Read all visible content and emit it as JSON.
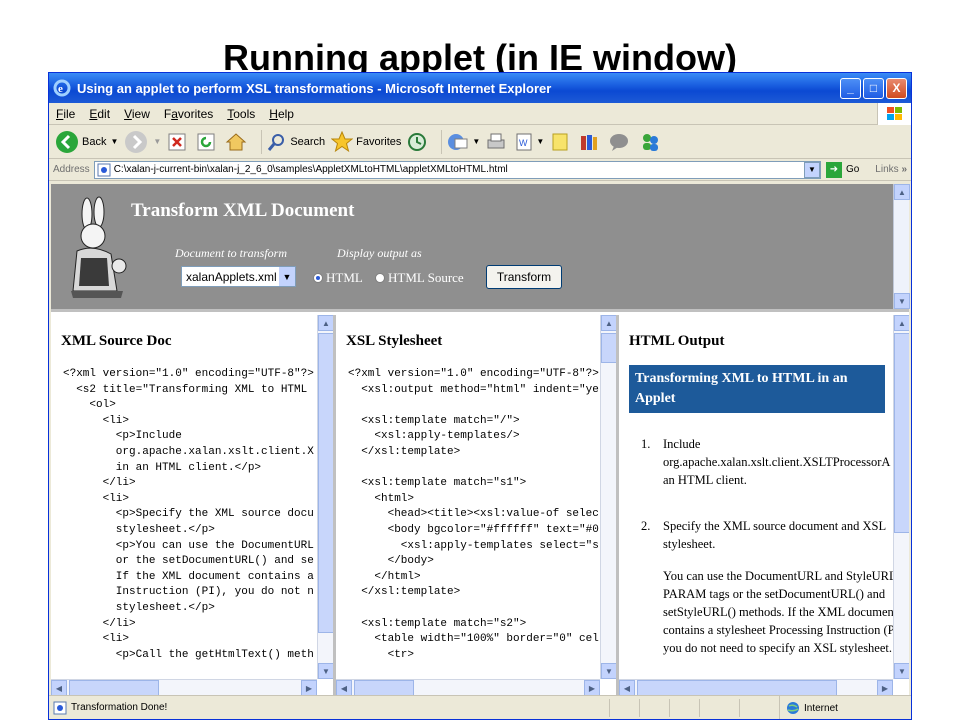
{
  "slide": {
    "title": "Running applet (in IE window)"
  },
  "window": {
    "title": "Using an applet to perform XSL transformations - Microsoft Internet Explorer",
    "controls": {
      "minimize": "_",
      "maximize": "□",
      "close": "X"
    }
  },
  "menu": {
    "items": [
      {
        "accel": "F",
        "rest": "ile"
      },
      {
        "accel": "E",
        "rest": "dit"
      },
      {
        "accel": "V",
        "rest": "iew"
      },
      {
        "accel": "a",
        "pre": "F",
        "rest": "vorites"
      },
      {
        "accel": "T",
        "rest": "ools"
      },
      {
        "accel": "H",
        "rest": "elp"
      }
    ]
  },
  "toolbar": {
    "back_label": "Back",
    "search_label": "Search",
    "favorites_label": "Favorites"
  },
  "address": {
    "label": "Address",
    "value": "C:\\xalan-j-current-bin\\xalan-j_2_6_0\\samples\\AppletXMLtoHTML\\appletXMLtoHTML.html",
    "go_label": "Go",
    "links_label": "Links"
  },
  "applet": {
    "heading": "Transform XML Document",
    "doc_label": "Document to transform",
    "display_label": "Display output as",
    "selected_doc": "xalanApplets.xml",
    "radio_html": "HTML",
    "radio_source": "HTML Source",
    "selected_output": "HTML",
    "transform_label": "Transform"
  },
  "panes": {
    "xml": {
      "title": "XML Source Doc",
      "code": "<?xml version=\"1.0\" encoding=\"UTF-8\"?>\n  <s2 title=\"Transforming XML to HTML\n    <ol>\n      <li>\n        <p>Include\n        org.apache.xalan.xslt.client.X\n        in an HTML client.</p>\n      </li>\n      <li>\n        <p>Specify the XML source docu\n        stylesheet.</p>\n        <p>You can use the DocumentURL\n        or the setDocumentURL() and se\n        If the XML document contains a\n        Instruction (PI), you do not n\n        stylesheet.</p>\n      </li>\n      <li>\n        <p>Call the getHtmlText() meth"
    },
    "xsl": {
      "title": "XSL Stylesheet",
      "code": "<?xml version=\"1.0\" encoding=\"UTF-8\"?>\n  <xsl:output method=\"html\" indent=\"ye\n\n  <xsl:template match=\"/\">\n    <xsl:apply-templates/>\n  </xsl:template>\n\n  <xsl:template match=\"s1\">\n    <html>\n      <head><title><xsl:value-of selec\n      <body bgcolor=\"#ffffff\" text=\"#0\n        <xsl:apply-templates select=\"s\n      </body>\n    </html>\n  </xsl:template>\n\n  <xsl:template match=\"s2\">\n    <table width=\"100%\" border=\"0\" cel\n      <tr>"
    },
    "output": {
      "title": "HTML Output",
      "banner": "Transforming XML to HTML in an Applet",
      "items": [
        {
          "num": "1.",
          "paras": [
            "Include org.apache.xalan.xslt.client.XSLTProcessorA in an HTML client."
          ]
        },
        {
          "num": "2.",
          "paras": [
            "Specify the XML source document and XSL stylesheet.",
            "You can use the DocumentURL and StyleURL PARAM tags or the setDocumentURL() and setStyleURL() methods. If the XML document contains a stylesheet Processing Instruction (PI), you do not need to specify an XSL stylesheet."
          ]
        }
      ]
    }
  },
  "status": {
    "text": "Transformation Done!",
    "zone": "Internet"
  },
  "colors": {
    "titlebar": "#0b49d3",
    "banner": "#1d5a9a",
    "applet_bg": "#8f8f8f"
  }
}
